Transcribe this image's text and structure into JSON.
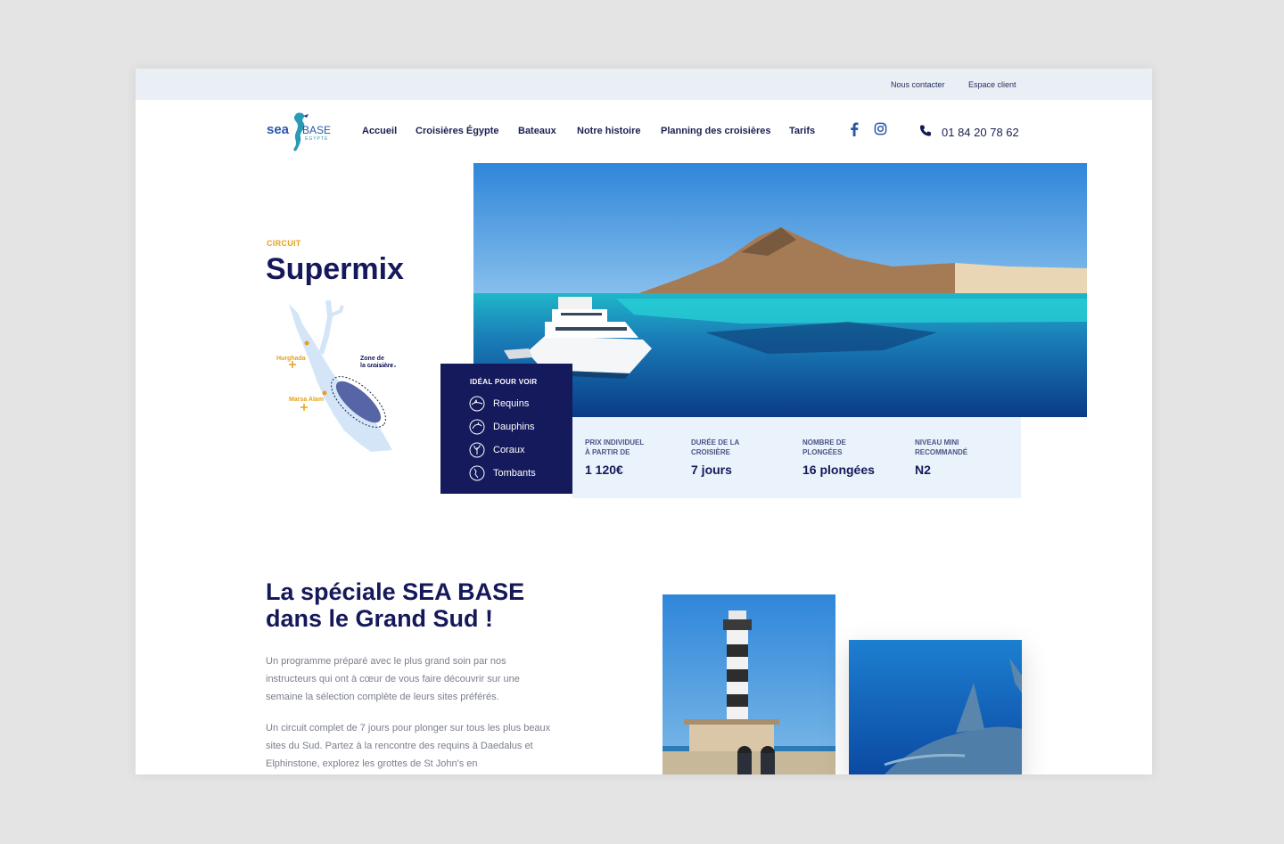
{
  "topbar": {
    "contact": "Nous contacter",
    "client": "Espace client"
  },
  "logo": {
    "sea": "sea",
    "base": "BASE",
    "egypte": "EGYPTE"
  },
  "nav": [
    "Accueil",
    "Croisières Égypte",
    "Bateaux",
    "Notre histoire",
    "Planning des croisières",
    "Tarifs"
  ],
  "phone": "01 84 20 78 62",
  "circuit": {
    "label": "CIRCUIT",
    "title": "Supermix"
  },
  "map": {
    "zone": [
      "Zone de",
      "la croisière"
    ],
    "hurghada": "Hurghada",
    "marsa": "Marsa Alam"
  },
  "ideal": {
    "title": "IDÉAL POUR VOIR",
    "items": [
      "Requins",
      "Dauphins",
      "Coraux",
      "Tombants"
    ]
  },
  "info": [
    {
      "label": [
        "PRIX INDIVIDUEL",
        "À PARTIR DE"
      ],
      "value": "1 120€"
    },
    {
      "label": [
        "DURÉE DE LA",
        "CROISIÈRE"
      ],
      "value": "7 jours"
    },
    {
      "label": [
        "NOMBRE DE",
        "PLONGÉES"
      ],
      "value": "16 plongées"
    },
    {
      "label": [
        "NIVEAU MINI",
        "RECOMMANDÉ"
      ],
      "value": "N2"
    }
  ],
  "section": {
    "title": "La spéciale SEA BASE dans le Grand Sud !",
    "p1": "Un programme préparé avec le plus grand soin par nos instructeurs qui ont à cœur de vous faire découvrir sur une semaine la sélection complète de leurs sites préférés.",
    "p2": "Un circuit complet de 7 jours pour plonger sur tous les plus beaux sites du Sud. Partez à la rencontre des requins à Daedalus et Elphinstone, explorez les grottes de St John's en"
  },
  "colors": {
    "navy": "#141a5c",
    "accent": "#e6a11c",
    "panel": "#eaf2fb",
    "topbar": "#e9eff4"
  }
}
